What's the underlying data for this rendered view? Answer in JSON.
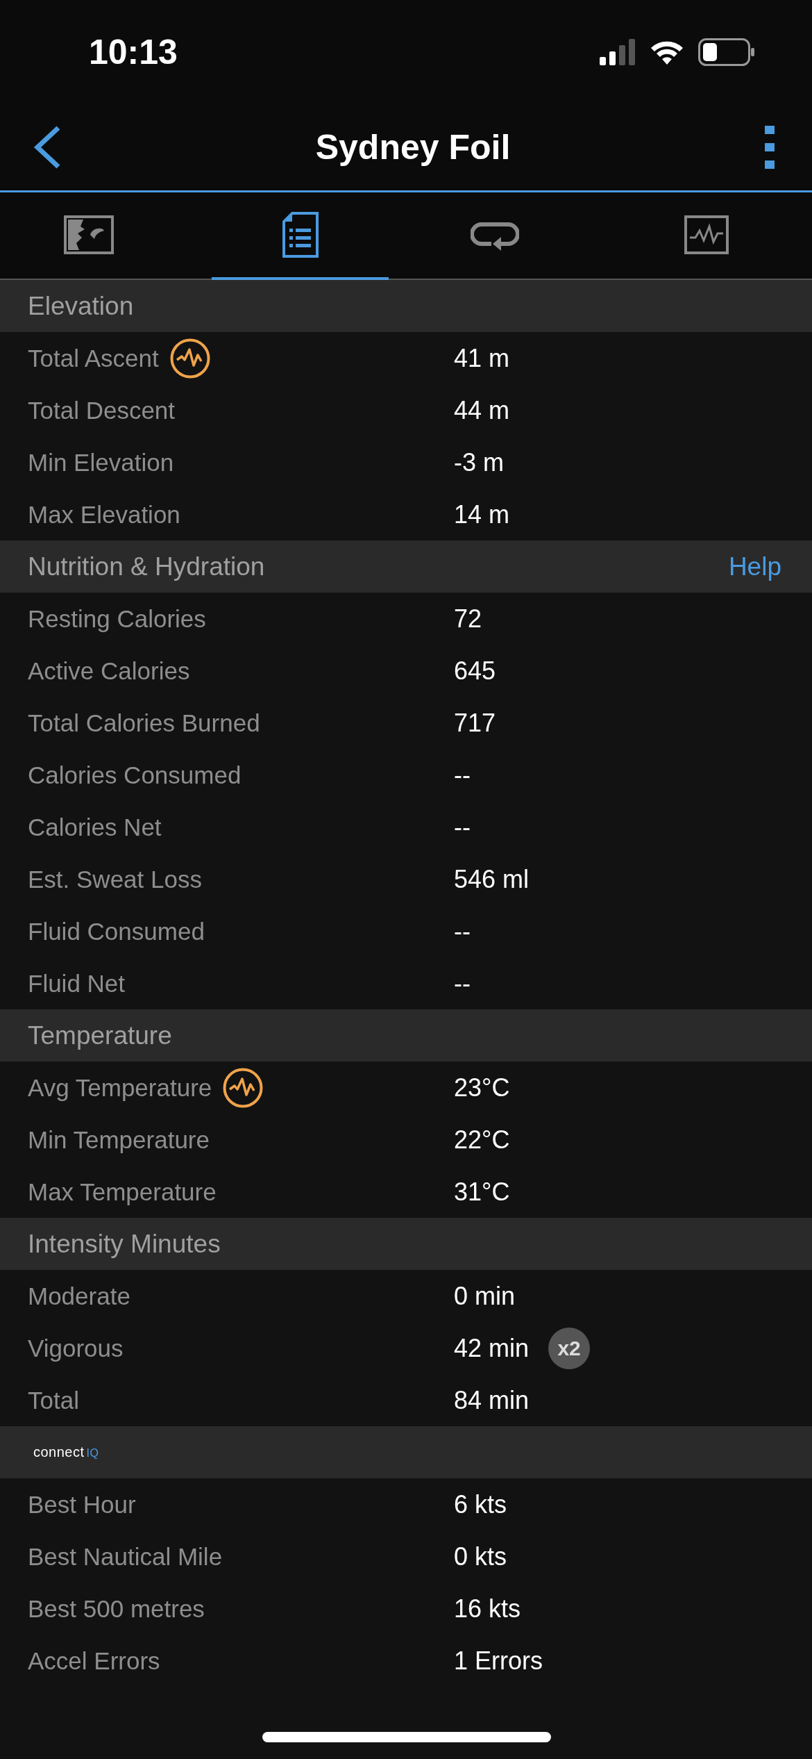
{
  "status_bar": {
    "time": "10:13"
  },
  "nav": {
    "title": "Sydney Foil"
  },
  "tabs": [
    {
      "kind": "map",
      "selected": false
    },
    {
      "kind": "summary",
      "selected": true
    },
    {
      "kind": "laps",
      "selected": false
    },
    {
      "kind": "chart",
      "selected": false
    }
  ],
  "sections": [
    {
      "kind": "text",
      "title": "Elevation",
      "rows": [
        {
          "label": "Total Ascent",
          "value": "41 m",
          "chart_icon": true
        },
        {
          "label": "Total Descent",
          "value": "44 m",
          "chart_icon": false
        },
        {
          "label": "Min Elevation",
          "value": "-3 m",
          "chart_icon": false
        },
        {
          "label": "Max Elevation",
          "value": "14 m",
          "chart_icon": false
        }
      ]
    },
    {
      "kind": "text",
      "title": "Nutrition & Hydration",
      "action": "Help",
      "rows": [
        {
          "label": "Resting Calories",
          "value": "72",
          "chart_icon": false
        },
        {
          "label": "Active Calories",
          "value": "645",
          "chart_icon": false
        },
        {
          "label": "Total Calories Burned",
          "value": "717",
          "chart_icon": false
        },
        {
          "label": "Calories Consumed",
          "value": "--",
          "chart_icon": false
        },
        {
          "label": "Calories Net",
          "value": "--",
          "chart_icon": false
        },
        {
          "label": "Est. Sweat Loss",
          "value": "546 ml",
          "chart_icon": false
        },
        {
          "label": "Fluid Consumed",
          "value": "--",
          "chart_icon": false
        },
        {
          "label": "Fluid Net",
          "value": "--",
          "chart_icon": false
        }
      ]
    },
    {
      "kind": "text",
      "title": "Temperature",
      "rows": [
        {
          "label": "Avg Temperature",
          "value": "23°C",
          "chart_icon": true
        },
        {
          "label": "Min Temperature",
          "value": "22°C",
          "chart_icon": false
        },
        {
          "label": "Max Temperature",
          "value": "31°C",
          "chart_icon": false
        }
      ]
    },
    {
      "kind": "text",
      "title": "Intensity Minutes",
      "rows": [
        {
          "label": "Moderate",
          "value": "0 min",
          "chart_icon": false
        },
        {
          "label": "Vigorous",
          "value": "42 min",
          "chart_icon": false,
          "badge": "x2"
        },
        {
          "label": "Total",
          "value": "84 min",
          "chart_icon": false
        }
      ]
    },
    {
      "kind": "logo",
      "logo": {
        "text": "connect",
        "accent": "IQ"
      },
      "rows": [
        {
          "label": "Best Hour",
          "value": "6 kts",
          "chart_icon": false
        },
        {
          "label": "Best Nautical Mile",
          "value": "0 kts",
          "chart_icon": false
        },
        {
          "label": "Best 500 metres",
          "value": "16 kts",
          "chart_icon": false
        },
        {
          "label": "Accel Errors",
          "value": "1 Errors",
          "chart_icon": false
        }
      ]
    }
  ]
}
